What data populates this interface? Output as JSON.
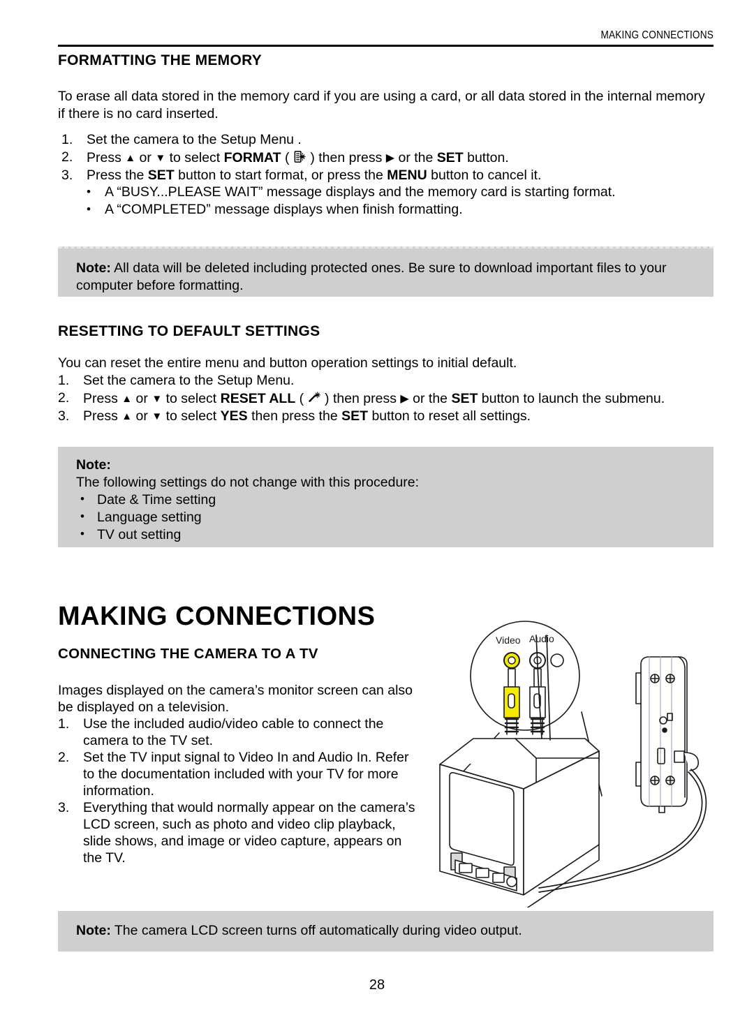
{
  "header": {
    "running_head": "MAKING CONNECTIONS"
  },
  "section_format": {
    "heading": "FORMATTING THE MEMORY",
    "intro": "To erase all data stored in the memory card if you are using a card, or all data stored in the internal memory if there is no card inserted.",
    "steps": [
      {
        "num": "1.",
        "parts": [
          {
            "t": "Set the camera to the Setup Menu ."
          }
        ]
      },
      {
        "num": "2.",
        "parts": [
          {
            "t": "Press "
          },
          {
            "icon": "triangle-up"
          },
          {
            "t": " or "
          },
          {
            "icon": "triangle-down"
          },
          {
            "t": " to select "
          },
          {
            "b": "FORMAT"
          },
          {
            "t": " ( "
          },
          {
            "icon": "format-icon"
          },
          {
            "t": " ) then press "
          },
          {
            "icon": "triangle-right"
          },
          {
            "t": " or the "
          },
          {
            "b": "SET"
          },
          {
            "t": " button."
          }
        ]
      },
      {
        "num": "3.",
        "parts": [
          {
            "t": "Press the "
          },
          {
            "b": "SET"
          },
          {
            "t": " button to start format, or press the "
          },
          {
            "b": "MENU"
          },
          {
            "t": " button to cancel it."
          }
        ]
      }
    ],
    "bullets": [
      "A “BUSY...PLEASE WAIT” message displays and the memory card is starting format.",
      "A “COMPLETED” message displays when finish formatting."
    ]
  },
  "note_format": {
    "label": "Note:",
    "text": " All data will be deleted including protected ones.  Be sure to download important files to your computer before formatting."
  },
  "section_reset": {
    "heading": "RESETTING TO DEFAULT SETTINGS",
    "intro": "You can reset the entire menu and button operation settings to initial default.",
    "steps": [
      {
        "num": "1.",
        "parts": [
          {
            "t": "Set the camera to the Setup Menu."
          }
        ]
      },
      {
        "num": "2.",
        "parts": [
          {
            "t": "Press "
          },
          {
            "icon": "triangle-up"
          },
          {
            "t": " or "
          },
          {
            "icon": "triangle-down"
          },
          {
            "t": " to select "
          },
          {
            "b": "RESET ALL"
          },
          {
            "t": " ( "
          },
          {
            "icon": "reset-icon"
          },
          {
            "t": " ) then press "
          },
          {
            "icon": "triangle-right"
          },
          {
            "t": " or the "
          },
          {
            "b": "SET"
          },
          {
            "t": " button to launch the submenu."
          }
        ]
      },
      {
        "num": "3.",
        "parts": [
          {
            "t": "Press "
          },
          {
            "icon": "triangle-up"
          },
          {
            "t": " or "
          },
          {
            "icon": "triangle-down"
          },
          {
            "t": " to select "
          },
          {
            "b": "YES"
          },
          {
            "t": " then press the "
          },
          {
            "b": "SET"
          },
          {
            "t": " button to reset all settings."
          }
        ]
      }
    ]
  },
  "note_reset": {
    "label": "Note:",
    "line": "The following settings do not change with this procedure:",
    "items": [
      "Date & Time setting",
      "Language setting",
      "TV out setting"
    ]
  },
  "chapter": {
    "title": "MAKING CONNECTIONS"
  },
  "section_tv": {
    "heading": "CONNECTING THE CAMERA TO A TV",
    "intro": "Images displayed on the camera’s monitor screen can also be displayed on a television.",
    "steps": [
      {
        "num": "1.",
        "text": "Use the included audio/video cable to connect the camera to the TV set."
      },
      {
        "num": "2.",
        "text": "Set the TV input signal to Video In and Audio In. Refer to the documentation included with your TV for more information."
      },
      {
        "num": "3.",
        "text": "Everything that would normally appear on the camera’s LCD screen, such as photo and video clip playback, slide shows, and image or video capture, appears on the TV."
      }
    ]
  },
  "illustration": {
    "callout_labels": {
      "video": "Video",
      "audio": "Audio"
    },
    "colors": {
      "video_plug": "#f5ea00",
      "audio_plug": "#ffffff",
      "line": "#1a1a1a"
    }
  },
  "note_tv": {
    "label": "Note:",
    "text": " The camera LCD screen turns off automatically during video output."
  },
  "footer": {
    "page_number": "28"
  },
  "colors": {
    "note_background": "#cfcfcf",
    "text": "#000000",
    "rule": "#000000"
  }
}
